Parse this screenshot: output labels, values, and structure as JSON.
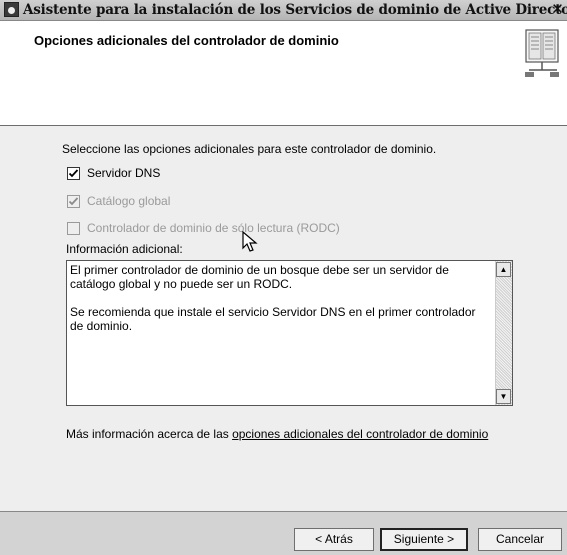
{
  "window": {
    "title": "Asistente para la instalación de los Servicios de dominio de Active Directory",
    "close_glyph": "✕"
  },
  "header": {
    "title": "Opciones adicionales del controlador de dominio",
    "icon": "directory-book-icon"
  },
  "main": {
    "prompt": "Seleccione las opciones adicionales para este controlador de dominio.",
    "options": [
      {
        "label": "Servidor DNS",
        "checked": true,
        "enabled": true
      },
      {
        "label": "Catálogo global",
        "checked": true,
        "enabled": false
      },
      {
        "label": "Controlador de dominio de sólo lectura (RODC)",
        "checked": false,
        "enabled": false
      }
    ],
    "info_label": "Información adicional:",
    "info_paragraphs": [
      "El primer controlador de dominio de un bosque debe ser un servidor de catálogo global y no puede ser un RODC.",
      "Se recomienda que instale el servicio Servidor DNS en el primer controlador de dominio."
    ],
    "more_info_prefix": "Más información acerca de las ",
    "more_info_link": "opciones adicionales del controlador de dominio"
  },
  "footer": {
    "back": "< Atrás",
    "next": "Siguiente >",
    "cancel": "Cancelar"
  }
}
